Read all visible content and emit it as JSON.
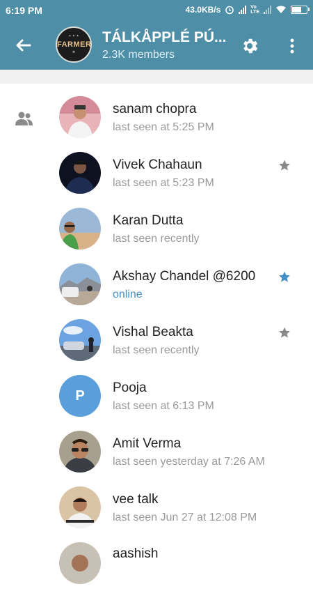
{
  "status_bar": {
    "time": "6:19 PM",
    "speed": "43.0KB/s"
  },
  "header": {
    "title": "TÁLKÅPPLÉ PÚ...",
    "subtitle": "2.3K members",
    "avatar_text": "FARMER",
    "colors": {
      "toolbar": "#4e8ea6"
    }
  },
  "members": [
    {
      "name": "sanam chopra",
      "status": "last seen at 5:25 PM",
      "star": "none",
      "avatar": "photo"
    },
    {
      "name": "Vivek Chahaun",
      "status": "last seen at 5:23 PM",
      "star": "grey",
      "avatar": "photo"
    },
    {
      "name": "Karan Dutta",
      "status": "last seen recently",
      "star": "none",
      "avatar": "photo"
    },
    {
      "name": "Akshay Chandel @6200",
      "status": "online",
      "star": "blue",
      "avatar": "photo"
    },
    {
      "name": "Vishal Beakta",
      "status": "last seen recently",
      "star": "grey",
      "avatar": "photo"
    },
    {
      "name": "Pooja",
      "status": "last seen at 6:13 PM",
      "star": "none",
      "avatar": "letter",
      "letter": "P"
    },
    {
      "name": "Amit Verma",
      "status": "last seen yesterday at 7:26 AM",
      "star": "none",
      "avatar": "photo"
    },
    {
      "name": "vee talk",
      "status": "last seen Jun 27 at 12:08 PM",
      "star": "none",
      "avatar": "photo"
    },
    {
      "name": "aashish",
      "status": "",
      "star": "none",
      "avatar": "photo"
    }
  ],
  "colors": {
    "star_grey": "#8a8a8a",
    "star_blue": "#3f8ec4",
    "online": "#3f8ec4",
    "letter_avatar": "#5a9edb"
  }
}
